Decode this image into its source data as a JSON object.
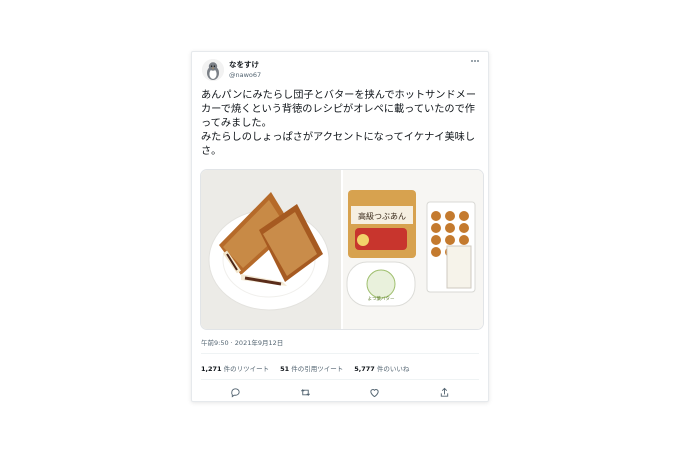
{
  "tweet": {
    "author": {
      "display_name": "なをすけ",
      "handle": "@nawo67",
      "avatar": "penguin-icon"
    },
    "text": "あんパンにみたらし団子とバターを挟んでホットサンドメーカーで焼くという背徳のレシピがオレペに載っていたので作ってみました。\nみたらしのしょっぱさがアクセントになってイケナイ美味しさ。",
    "media": {
      "left_image": "hot-sandwich-photo",
      "right_image": "ingredients-photo",
      "bread_package_text": "高級つぶあん",
      "butter_label": "よつ葉バター"
    },
    "timestamp": "午前9:50 · 2021年9月12日",
    "stats": {
      "retweets": {
        "count": "1,271",
        "label": "件のリツイート"
      },
      "quotes": {
        "count": "51",
        "label": "件の引用ツイート"
      },
      "likes": {
        "count": "5,777",
        "label": "件のいいね"
      }
    },
    "actions": [
      "reply-icon",
      "retweet-icon",
      "like-icon",
      "share-icon"
    ]
  },
  "colors": {
    "text": "#0f1419",
    "secondary": "#536471",
    "border": "#e6e9ec"
  }
}
